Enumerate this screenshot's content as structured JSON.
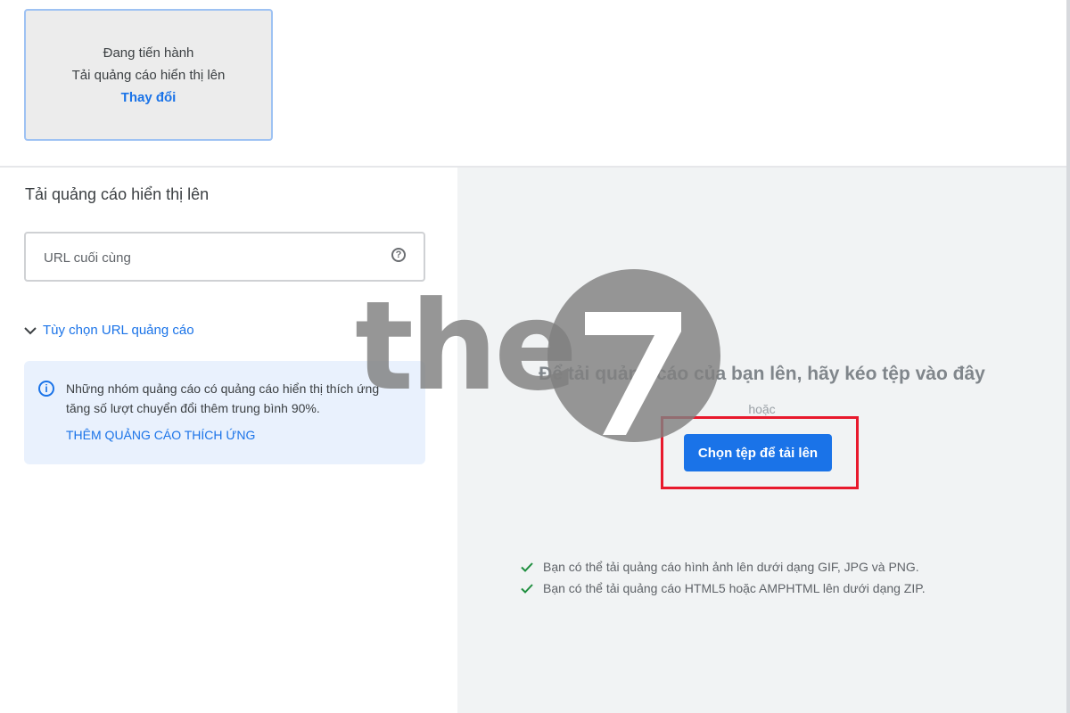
{
  "step_card": {
    "status": "Đang tiến hành",
    "title": "Tải quảng cáo hiển thị lên",
    "change_link": "Thay đổi"
  },
  "left_panel": {
    "title": "Tải quảng cáo hiển thị lên",
    "final_url": {
      "placeholder": "URL cuối cùng",
      "value": ""
    },
    "url_options_label": "Tùy chọn URL quảng cáo",
    "info": {
      "text": "Những nhóm quảng cáo có quảng cáo hiển thị thích ứng tăng số lượt chuyển đổi thêm trung bình 90%.",
      "link": "THÊM QUẢNG CÁO THÍCH ỨNG"
    }
  },
  "right_panel": {
    "drop_heading": "Để tải quảng cáo của bạn lên, hãy kéo tệp vào đây",
    "or_text": "hoặc",
    "upload_button": "Chọn tệp để tải lên",
    "notes": [
      "Bạn có thể tải quảng cáo hình ảnh lên dưới dạng GIF, JPG và PNG.",
      "Bạn có thể tải quảng cáo HTML5 hoặc AMPHTML lên dưới dạng ZIP."
    ]
  },
  "watermark": {
    "text": "the",
    "mark": "7"
  },
  "colors": {
    "accent": "#1a73e8",
    "highlight_border": "#e8192c",
    "check": "#1e8e3e",
    "panel_bg": "#f1f3f4"
  }
}
